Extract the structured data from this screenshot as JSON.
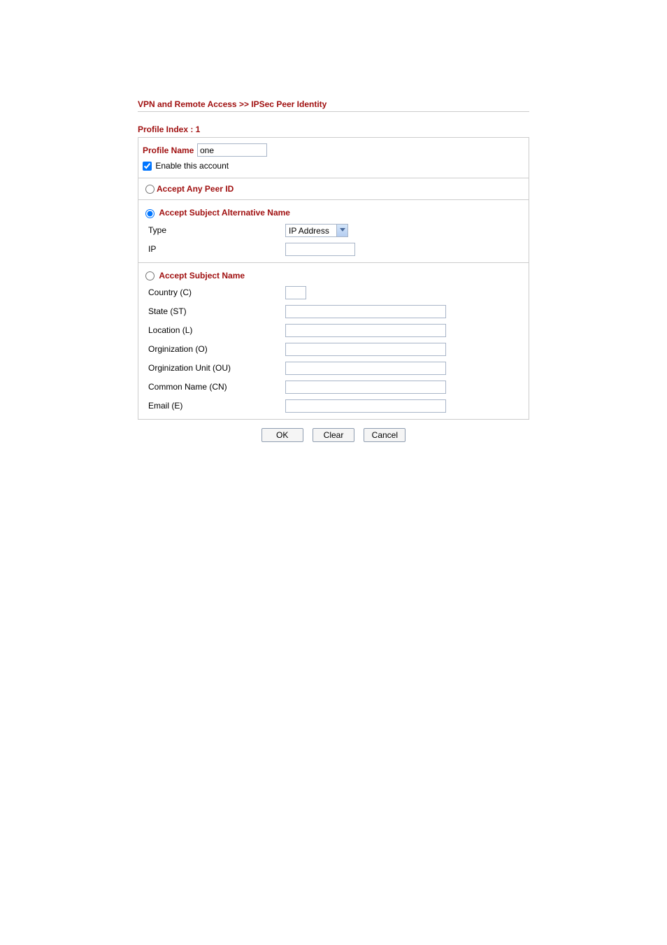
{
  "breadcrumb": "VPN and Remote Access >> IPSec Peer Identity",
  "profileIndex": "Profile Index : 1",
  "profileName": {
    "label": "Profile Name",
    "value": "one"
  },
  "enable": {
    "label": "Enable this account",
    "checked": true
  },
  "acceptAnyPeerId": {
    "label": "Accept Any Peer ID",
    "selected": false
  },
  "acceptSan": {
    "label": "Accept Subject Alternative Name",
    "selected": true,
    "typeLabel": "Type",
    "typeValue": "IP Address",
    "ipLabel": "IP",
    "ipValue": ""
  },
  "acceptSubjectName": {
    "label": "Accept Subject Name",
    "selected": false,
    "fields": {
      "country": {
        "label": "Country (C)",
        "value": ""
      },
      "state": {
        "label": "State (ST)",
        "value": ""
      },
      "location": {
        "label": "Location (L)",
        "value": ""
      },
      "org": {
        "label": "Orginization (O)",
        "value": ""
      },
      "orgUnit": {
        "label": "Orginization Unit (OU)",
        "value": ""
      },
      "commonName": {
        "label": "Common Name (CN)",
        "value": ""
      },
      "email": {
        "label": "Email (E)",
        "value": ""
      }
    }
  },
  "buttons": {
    "ok": "OK",
    "clear": "Clear",
    "cancel": "Cancel"
  }
}
